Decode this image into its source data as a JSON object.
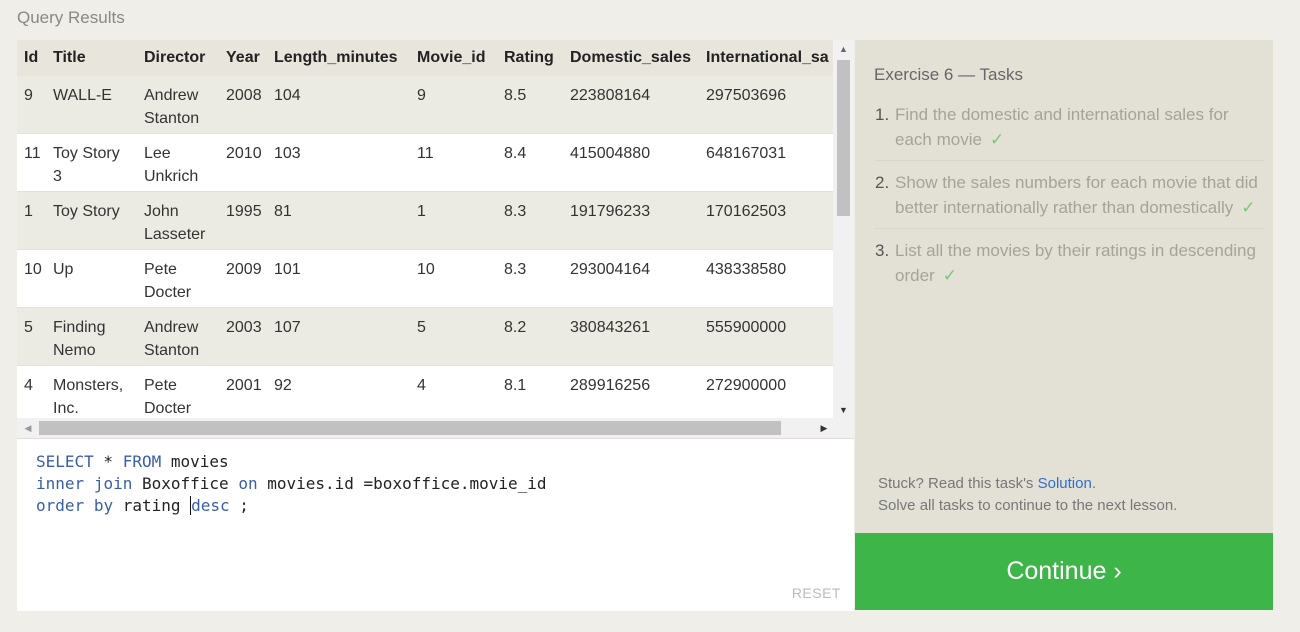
{
  "header": {
    "title": "Query Results"
  },
  "table": {
    "columns": [
      "Id",
      "Title",
      "Director",
      "Year",
      "Length_minutes",
      "Movie_id",
      "Rating",
      "Domestic_sales",
      "International_sa"
    ],
    "rows": [
      [
        "9",
        "WALL-E",
        "Andrew Stanton",
        "2008",
        "104",
        "9",
        "8.5",
        "223808164",
        "297503696"
      ],
      [
        "11",
        "Toy Story 3",
        "Lee Unkrich",
        "2010",
        "103",
        "11",
        "8.4",
        "415004880",
        "648167031"
      ],
      [
        "1",
        "Toy Story",
        "John Lasseter",
        "1995",
        "81",
        "1",
        "8.3",
        "191796233",
        "170162503"
      ],
      [
        "10",
        "Up",
        "Pete Docter",
        "2009",
        "101",
        "10",
        "8.3",
        "293004164",
        "438338580"
      ],
      [
        "5",
        "Finding Nemo",
        "Andrew Stanton",
        "2003",
        "107",
        "5",
        "8.2",
        "380843261",
        "555900000"
      ],
      [
        "4",
        "Monsters, Inc.",
        "Pete Docter",
        "2001",
        "92",
        "4",
        "8.1",
        "289916256",
        "272900000"
      ]
    ]
  },
  "editor": {
    "lines": [
      [
        {
          "t": "SELECT",
          "kw": true
        },
        {
          "t": " * ",
          "kw": false
        },
        {
          "t": "FROM",
          "kw": true
        },
        {
          "t": " movies",
          "kw": false
        }
      ],
      [
        {
          "t": "inner",
          "kw": true
        },
        {
          "t": " ",
          "kw": false
        },
        {
          "t": "join",
          "kw": true
        },
        {
          "t": " Boxoffice ",
          "kw": false
        },
        {
          "t": "on",
          "kw": true
        },
        {
          "t": " movies.id =boxoffice.movie_id",
          "kw": false
        }
      ],
      [
        {
          "t": "order",
          "kw": true
        },
        {
          "t": " ",
          "kw": false
        },
        {
          "t": "by",
          "kw": true
        },
        {
          "t": " rating ",
          "kw": false
        },
        {
          "t": "desc",
          "kw": true,
          "cursor": true
        },
        {
          "t": " ;",
          "kw": false
        }
      ]
    ],
    "reset_label": "RESET"
  },
  "tasks": {
    "title": "Exercise 6 — Tasks",
    "items": [
      {
        "num": "1.",
        "text": "Find the domestic and international sales for each movie",
        "done": true
      },
      {
        "num": "2.",
        "text": "Show the sales numbers for each movie that did better internationally rather than domestically",
        "done": true
      },
      {
        "num": "3.",
        "text": "List all the movies by their ratings in descending order",
        "done": true
      }
    ],
    "check_glyph": "✓",
    "stuck_prefix": "Stuck? Read this task's ",
    "solution_link": "Solution",
    "stuck_suffix": ".",
    "solve_all": "Solve all tasks to continue to the next lesson."
  },
  "continue_label": "Continue ›",
  "icons": {
    "scroll_up": "▲",
    "scroll_down": "▼",
    "scroll_left": "◀",
    "scroll_right": "▶"
  }
}
